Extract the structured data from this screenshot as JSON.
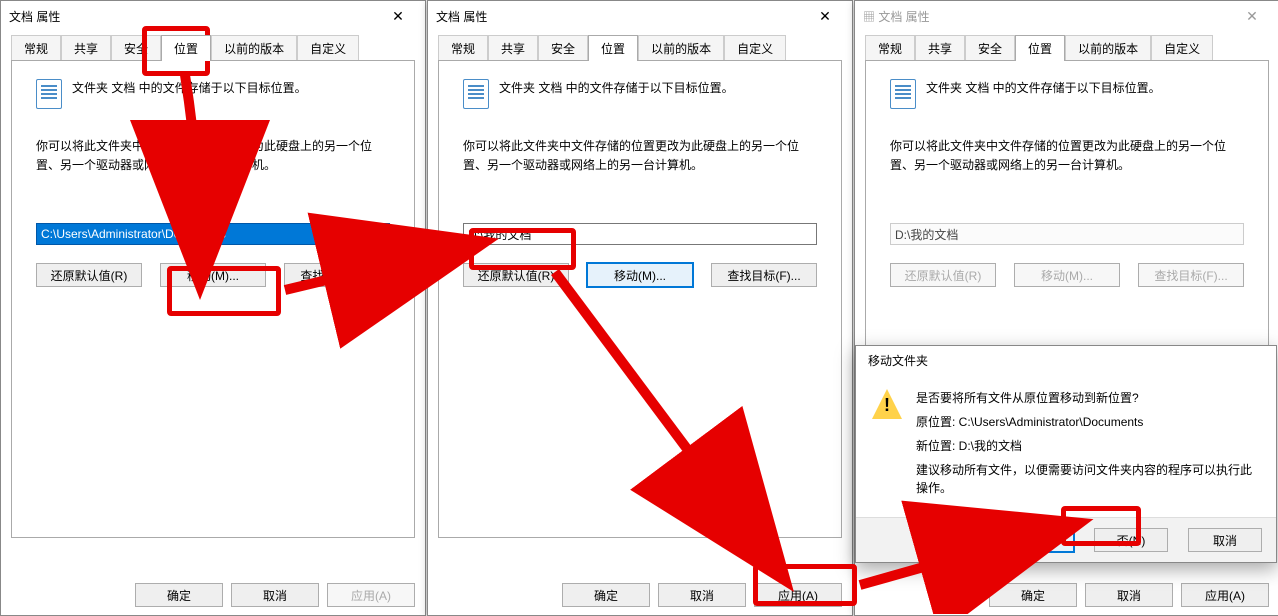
{
  "dialogs": {
    "title": "文档 属性",
    "tabs": [
      "常规",
      "共享",
      "安全",
      "位置",
      "以前的版本",
      "自定义"
    ],
    "active_tab": "位置",
    "info1": "文件夹 文档 中的文件存储于以下目标位置。",
    "info2": "你可以将此文件夹中文件存储的位置更改为此硬盘上的另一个位置、另一个驱动器或网络上的另一台计算机。",
    "path1": "C:\\Users\\Administrator\\Documents",
    "path2": "D:\\我的文档",
    "path3": "D:\\我的文档",
    "btn_restore": "还原默认值(R)",
    "btn_move": "移动(M)...",
    "btn_find": "查找目标(F)...",
    "btn_ok": "确定",
    "btn_cancel": "取消",
    "btn_apply": "应用(A)"
  },
  "confirm": {
    "title": "移动文件夹",
    "q": "是否要将所有文件从原位置移动到新位置?",
    "old_label": "原位置: C:\\Users\\Administrator\\Documents",
    "new_label": "新位置: D:\\我的文档",
    "advice": "建议移动所有文件，以便需要访问文件夹内容的程序可以执行此操作。",
    "yes": "是(Y)",
    "no": "否(N)",
    "cancel": "取消"
  }
}
